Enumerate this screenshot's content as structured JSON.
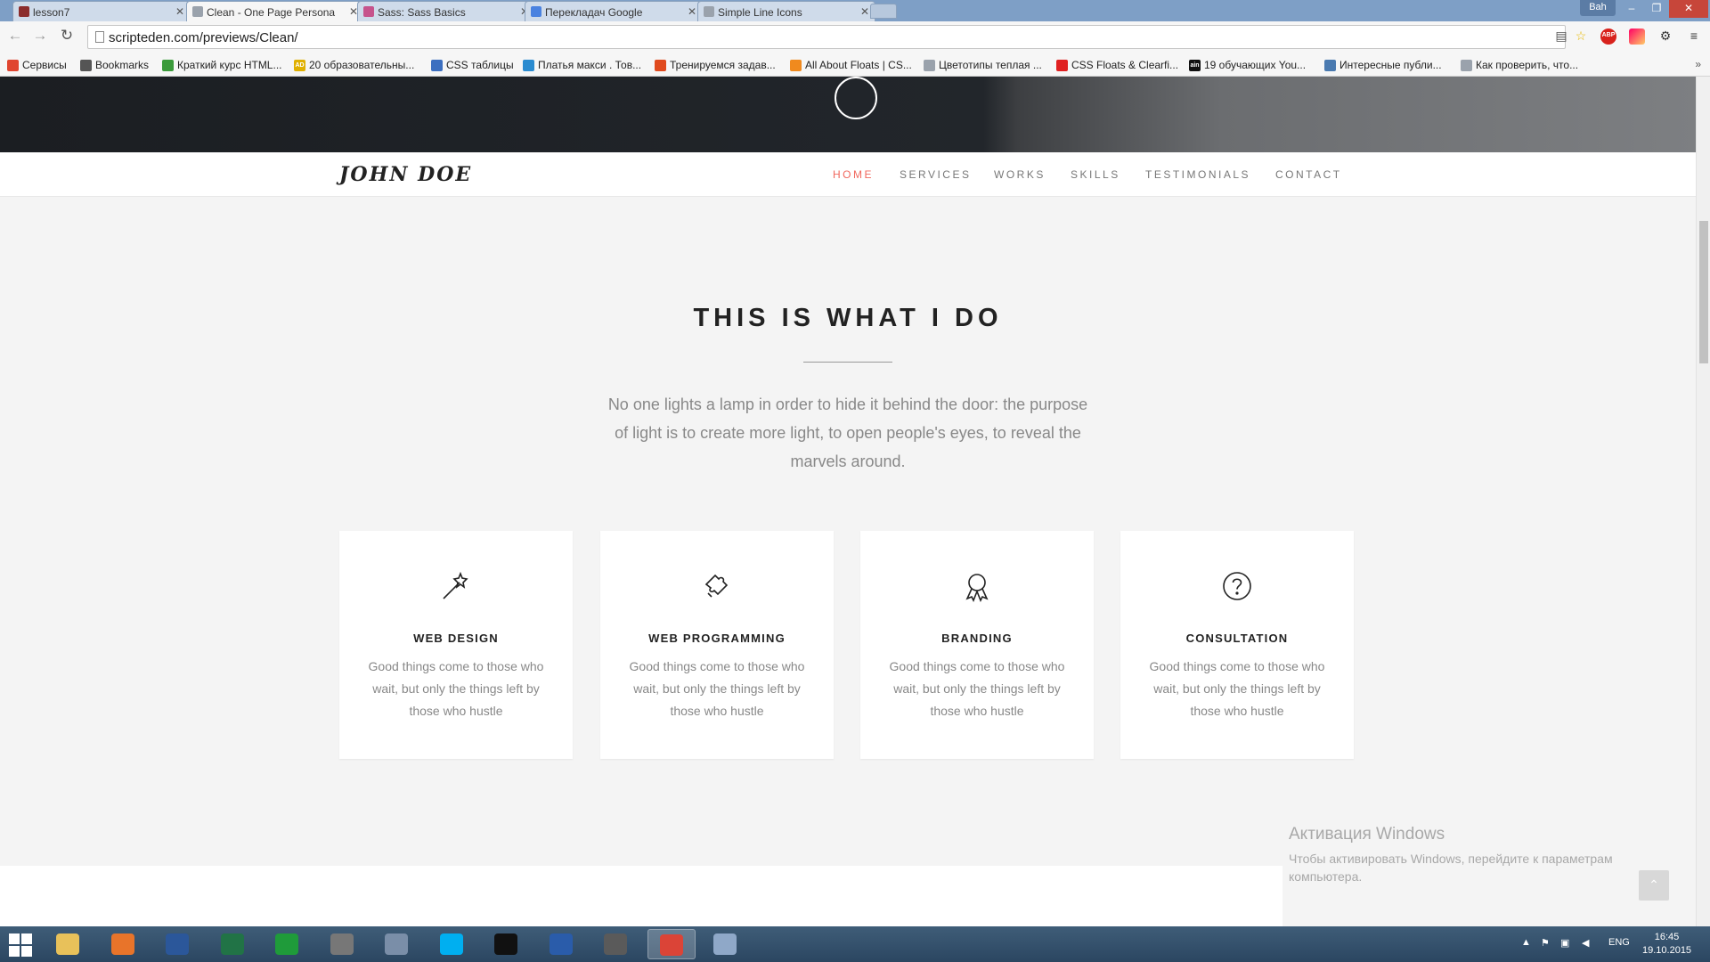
{
  "browser": {
    "tabs": [
      {
        "title": "lesson7",
        "active": false,
        "favicon_color": "#8b2d2d"
      },
      {
        "title": "Clean - One Page Persona",
        "active": true,
        "favicon_color": "#9aa2ac"
      },
      {
        "title": "Sass: Sass Basics",
        "active": false,
        "favicon_color": "#c6538c"
      },
      {
        "title": "Перекладач Google",
        "active": false,
        "favicon_color": "#4a82e0"
      },
      {
        "title": "Simple Line Icons",
        "active": false,
        "favicon_color": "#9aa2ac"
      }
    ],
    "profile_name": "Bah",
    "url": "scripteden.com/previews/Clean/",
    "bookmarks": [
      {
        "label": "Сервисы",
        "icon_color": "#e0452f"
      },
      {
        "label": "Bookmarks",
        "icon_color": "#555555"
      },
      {
        "label": "Краткий курс HTML...",
        "icon_color": "#3a9a3a"
      },
      {
        "label": "20 образовательны...",
        "icon_color": "#e0b000",
        "icon_text": "AD"
      },
      {
        "label": "CSS таблицы",
        "icon_color": "#3c6fc0"
      },
      {
        "label": "Платья макси . Тов...",
        "icon_color": "#2a8bd0"
      },
      {
        "label": "Тренируемся задав...",
        "icon_color": "#e04a1e"
      },
      {
        "label": "All About Floats | CS...",
        "icon_color": "#f08a1e"
      },
      {
        "label": "Цветотипы теплая ...",
        "icon_color": "#9aa2ac"
      },
      {
        "label": "CSS Floats & Clearfi...",
        "icon_color": "#e02020"
      },
      {
        "label": "19 обучающих You...",
        "icon_color": "#111111",
        "icon_text": "ain"
      },
      {
        "label": "Интересные публи...",
        "icon_color": "#4a7ab0"
      },
      {
        "label": "Как проверить, что...",
        "icon_color": "#9aa2ac"
      }
    ],
    "bookmarks_more": "»"
  },
  "site": {
    "logo": "JOHN DOE",
    "nav": [
      {
        "label": "HOME",
        "active": true
      },
      {
        "label": "SERVICES",
        "active": false
      },
      {
        "label": "WORKS",
        "active": false
      },
      {
        "label": "SKILLS",
        "active": false
      },
      {
        "label": "TESTIMONIALS",
        "active": false
      },
      {
        "label": "CONTACT",
        "active": false
      }
    ],
    "accent_color": "#f1685e",
    "section": {
      "title": "THIS IS WHAT I DO",
      "intro": "No one lights a lamp in order to hide it behind the door: the purpose of light is to create more light, to open people's eyes, to reveal the marvels around."
    },
    "services": [
      {
        "icon": "magic-wand-icon",
        "title": "WEB DESIGN",
        "text": "Good things come to those who wait, but only the things left by those who hustle"
      },
      {
        "icon": "puzzle-icon",
        "title": "WEB PROGRAMMING",
        "text": "Good things come to those who wait, but only the things left by those who hustle"
      },
      {
        "icon": "badge-icon",
        "title": "BRANDING",
        "text": "Good things come to those who wait, but only the things left by those who hustle"
      },
      {
        "icon": "question-icon",
        "title": "CONSULTATION",
        "text": "Good things come to those who wait, but only the things left by those who hustle"
      }
    ],
    "scroll_top": "⌃"
  },
  "os": {
    "activation_title": "Активация Windows",
    "activation_text": "Чтобы активировать Windows, перейдите к параметрам компьютера.",
    "language": "ENG",
    "time": "16:45",
    "date": "19.10.2015",
    "taskbar_apps": [
      {
        "name": "explorer",
        "color": "#e8c15a",
        "active": false
      },
      {
        "name": "firefox",
        "color": "#e8742a",
        "active": false
      },
      {
        "name": "word",
        "color": "#2b579a",
        "active": false
      },
      {
        "name": "excel",
        "color": "#217346",
        "active": false
      },
      {
        "name": "store",
        "color": "#1f9b3a",
        "active": false
      },
      {
        "name": "viewer",
        "color": "#777777",
        "active": false
      },
      {
        "name": "calculator",
        "color": "#7a8ea8",
        "active": false
      },
      {
        "name": "skype",
        "color": "#00aff0",
        "active": false
      },
      {
        "name": "cmd",
        "color": "#111111",
        "active": false
      },
      {
        "name": "powershell",
        "color": "#2a5caa",
        "active": false
      },
      {
        "name": "sublime",
        "color": "#5a5a5a",
        "active": false
      },
      {
        "name": "chrome",
        "color": "#db4437",
        "active": true
      },
      {
        "name": "paint",
        "color": "#8fa8c8",
        "active": false
      }
    ]
  }
}
